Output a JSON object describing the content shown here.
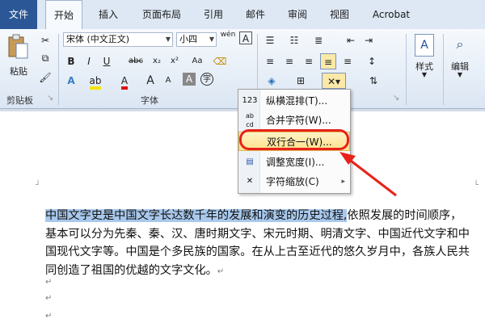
{
  "tabs": {
    "file": "文件",
    "home": "开始",
    "insert": "插入",
    "layout": "页面布局",
    "references": "引用",
    "mailings": "邮件",
    "review": "审阅",
    "view": "视图",
    "acrobat": "Acrobat"
  },
  "ribbon": {
    "clipboard": {
      "paste": "粘贴",
      "label": "剪贴板"
    },
    "font": {
      "family": "宋体 (中文正文)",
      "size": "小四",
      "label": "字体",
      "bold": "B",
      "italic": "I",
      "underline": "U",
      "abc": "abc",
      "aa": "Aa",
      "grow": "A",
      "phonetic": "wén",
      "big_a": "A"
    },
    "styles": {
      "label": "样式"
    },
    "editing": {
      "label": "编辑"
    }
  },
  "menu": {
    "items": [
      {
        "icon": "vertical-in-horizontal-icon",
        "icon_text": "123",
        "label": "纵横混排(T)..."
      },
      {
        "icon": "combine-characters-icon",
        "icon_text": "ab cd",
        "label": "合并字符(W)..."
      },
      {
        "icon": "two-lines-in-one-icon",
        "icon_text": "",
        "label": "双行合一(W)..."
      },
      {
        "icon": "fit-text-icon",
        "icon_text": "",
        "label": "调整宽度(I)..."
      },
      {
        "icon": "character-scaling-icon",
        "icon_text": "",
        "label": "字符缩放(C)",
        "submenu": "▸"
      }
    ]
  },
  "document": {
    "highlighted": "中国文字史是中国文字长达数千年的发展和演变的历史过程,",
    "rest": "依照发展的时间顺序，基本可以分为先秦、秦、汉、唐时期文字、宋元时期、明清文字、中国近代文字和中国现代文字等。中国是个多民族的国家。在从上古至近代的悠久岁月中，各族人民共同创造了祖国的优越的文字文化。",
    "para_mark": "↵"
  },
  "colors": {
    "accent": "#2b5796",
    "highlight": "#a8c8ec",
    "callout": "#e8221b"
  }
}
